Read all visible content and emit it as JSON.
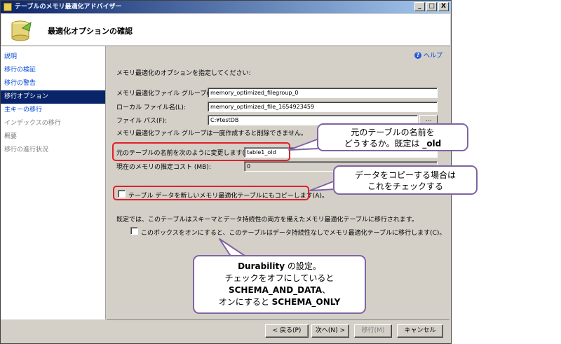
{
  "window": {
    "title": "テーブルのメモリ最適化アドバイザー",
    "buttons": {
      "minimize": "_",
      "maximize": "□",
      "close": "X"
    }
  },
  "header": {
    "title": "最適化オプションの確認"
  },
  "sidebar": {
    "items": [
      {
        "label": "説明",
        "state": "link"
      },
      {
        "label": "移行の検証",
        "state": "link"
      },
      {
        "label": "移行の警告",
        "state": "link"
      },
      {
        "label": "移行オプション",
        "state": "active"
      },
      {
        "label": "主キーの移行",
        "state": "link"
      },
      {
        "label": "インデックスの移行",
        "state": "disabled"
      },
      {
        "label": "概要",
        "state": "disabled"
      },
      {
        "label": "移行の進行状況",
        "state": "disabled"
      }
    ]
  },
  "main": {
    "help_label": "ヘルプ",
    "intro": "メモリ最適化のオプションを指定してください:",
    "filegroup_label": "メモリ最適化ファイル グループ(M):",
    "filegroup_value": "memory_optimized_filegroup_0",
    "logical_name_label": "ローカル ファイル名(L):",
    "logical_name_value": "memory_optimized_file_1654923459",
    "path_label": "ファイル パス(F):",
    "path_value": "C:¥testDB",
    "browse_label": "...",
    "filegroup_note": "メモリ最適化ファイル グループは一度作成すると削除できません。",
    "rename_label": "元のテーブルの名前を次のように変更します(R):",
    "rename_value": "table1_old",
    "cost_label": "現在のメモリの推定コスト (MB):",
    "cost_value": "0",
    "copy_data_label": "テーブル データを新しいメモリ最適化テーブルにもコピーします(A)。",
    "copy_data_checked": false,
    "durability_note": "既定では、このテーブルはスキーマとデータ持続性の両方を備えたメモリ最適化テーブルに移行されます。",
    "schema_only_label": "このボックスをオンにすると、このテーブルはデータ持続性なしでメモリ最適化テーブルに移行します(C)。",
    "schema_only_checked": false
  },
  "footer": {
    "back": "< 戻る(P)",
    "next": "次へ(N) >",
    "migrate": "移行(M)",
    "cancel": "キャンセル"
  },
  "callouts": {
    "rename": {
      "line1": "元のテーブルの名前を",
      "line2_pre": "どうするか。既定は ",
      "line2_bold": "_old"
    },
    "copy": {
      "line1": "データをコピーする場合は",
      "line2": "これをチェックする"
    },
    "durability": {
      "line1_bold": "Durability",
      "line1_rest": " の設定。",
      "line2": "チェックをオフにしていると",
      "line3_bold": "SCHEMA_AND_DATA",
      "line3_rest": "、",
      "line4_pre": "オンにすると ",
      "line4_bold": "SCHEMA_ONLY"
    }
  },
  "colors": {
    "title_bar": "#0a246a",
    "highlight_box": "#e0202a",
    "callout_border": "#8064a2",
    "link": "#0046d5"
  }
}
